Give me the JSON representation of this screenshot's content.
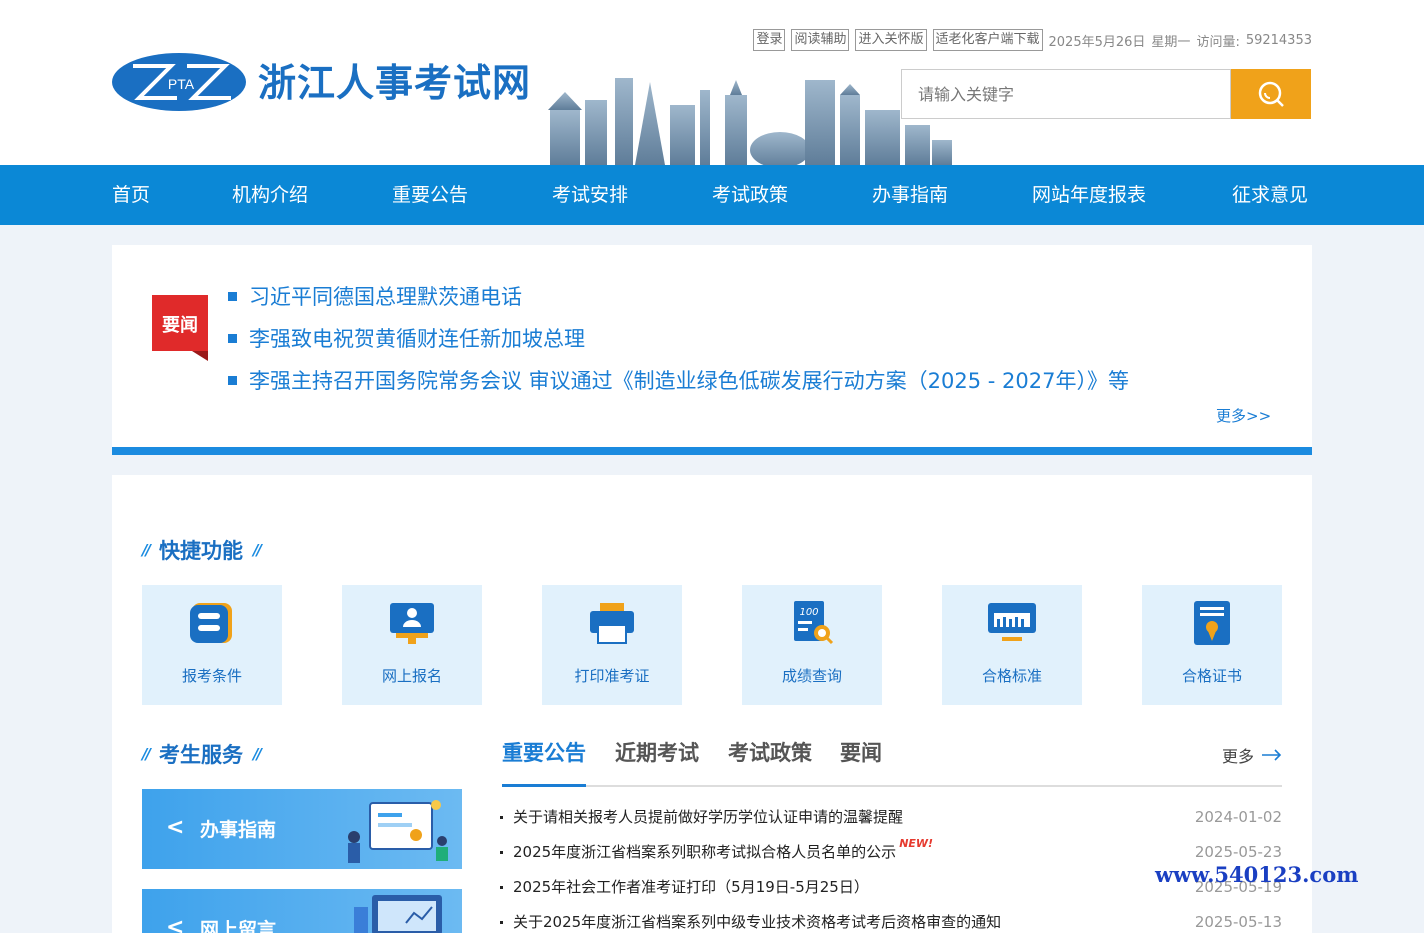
{
  "header": {
    "site_title": "浙江人事考试网",
    "logo_text": "PTA",
    "top_links": [
      "登录",
      "阅读辅助",
      "进入关怀版",
      "适老化客户端下载"
    ],
    "date": "2025年5月26日",
    "weekday": "星期一",
    "visits_label": "访问量:",
    "visits_count": "59214353",
    "search_placeholder": "请输入关键字"
  },
  "nav": [
    "首页",
    "机构介绍",
    "重要公告",
    "考试安排",
    "考试政策",
    "办事指南",
    "网站年度报表",
    "征求意见"
  ],
  "news": {
    "badge": "要闻",
    "items": [
      "习近平同德国总理默茨通电话",
      "李强致电祝贺黄循财连任新加坡总理",
      "李强主持召开国务院常务会议 审议通过《制造业绿色低碳发展行动方案（2025 - 2027年）》等"
    ],
    "more": "更多>>"
  },
  "quick": {
    "title": "快捷功能",
    "items": [
      {
        "label": "报考条件",
        "icon": "conditions-icon"
      },
      {
        "label": "网上报名",
        "icon": "online-register-icon"
      },
      {
        "label": "打印准考证",
        "icon": "printer-icon"
      },
      {
        "label": "成绩查询",
        "icon": "score-query-icon"
      },
      {
        "label": "合格标准",
        "icon": "standard-icon"
      },
      {
        "label": "合格证书",
        "icon": "certificate-icon"
      }
    ]
  },
  "service": {
    "title": "考生服务",
    "items": [
      "办事指南",
      "网上留言"
    ]
  },
  "tabs": {
    "items": [
      "重要公告",
      "近期考试",
      "考试政策",
      "要闻"
    ],
    "more": "更多",
    "announcements": [
      {
        "title": "关于请相关报考人员提前做好学历学位认证申请的温馨提醒",
        "date": "2024-01-02",
        "new": ""
      },
      {
        "title": "2025年度浙江省档案系列职称考试拟合格人员名单的公示",
        "date": "2025-05-23",
        "new": "NEW!"
      },
      {
        "title": "2025年社会工作者准考证打印（5月19日-5月25日）",
        "date": "2025-05-19",
        "new": ""
      },
      {
        "title": "关于2025年度浙江省档案系列中级专业技术资格考试考后资格审查的通知",
        "date": "2025-05-13",
        "new": ""
      }
    ]
  },
  "watermark": "www.540123.com",
  "colors": {
    "nav_blue": "#0b88d6",
    "accent_orange": "#f0a21a",
    "link_blue": "#1a7dd4",
    "badge_red": "#e02a2a"
  }
}
